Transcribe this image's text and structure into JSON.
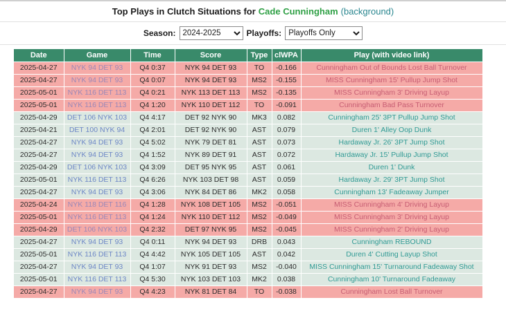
{
  "title": {
    "prefix": "Top Plays in Clutch Situations for",
    "player": "Cade Cunningham",
    "background_link": "(background)"
  },
  "controls": {
    "season_label": "Season:",
    "season_value": "2024-2025",
    "playoffs_label": "Playoffs:",
    "playoffs_value": "Playoffs Only"
  },
  "table": {
    "columns": [
      "Date",
      "Game",
      "Time",
      "Score",
      "Type",
      "clWPA",
      "Play (with video link)"
    ],
    "rows": [
      {
        "date": "2025-04-27",
        "game": "NYK 94 DET 93",
        "time": "Q4 0:37",
        "score": "NYK 94 DET 93",
        "type": "TO",
        "clwpa": "-0.166",
        "play": "Cunningham Out of Bounds Lost Ball Turnover",
        "tone": "pink"
      },
      {
        "date": "2025-04-27",
        "game": "NYK 94 DET 93",
        "time": "Q4 0:07",
        "score": "NYK 94 DET 93",
        "type": "MS2",
        "clwpa": "-0.155",
        "play": "MISS Cunningham 15' Pullup Jump Shot",
        "tone": "pink"
      },
      {
        "date": "2025-05-01",
        "game": "NYK 116 DET 113",
        "time": "Q4 0:21",
        "score": "NYK 113 DET 113",
        "type": "MS2",
        "clwpa": "-0.135",
        "play": "MISS Cunningham 3' Driving Layup",
        "tone": "pink"
      },
      {
        "date": "2025-05-01",
        "game": "NYK 116 DET 113",
        "time": "Q4 1:20",
        "score": "NYK 110 DET 112",
        "type": "TO",
        "clwpa": "-0.091",
        "play": "Cunningham Bad Pass Turnover",
        "tone": "pink"
      },
      {
        "date": "2025-04-29",
        "game": "DET 106 NYK 103",
        "time": "Q4 4:17",
        "score": "DET 92 NYK 90",
        "type": "MK3",
        "clwpa": "0.082",
        "play": "Cunningham 25' 3PT Pullup Jump Shot",
        "tone": "green"
      },
      {
        "date": "2025-04-21",
        "game": "DET 100 NYK 94",
        "time": "Q4 2:01",
        "score": "DET 92 NYK 90",
        "type": "AST",
        "clwpa": "0.079",
        "play": "Duren 1' Alley Oop Dunk",
        "tone": "green"
      },
      {
        "date": "2025-04-27",
        "game": "NYK 94 DET 93",
        "time": "Q4 5:02",
        "score": "NYK 79 DET 81",
        "type": "AST",
        "clwpa": "0.073",
        "play": "Hardaway Jr. 26' 3PT Jump Shot",
        "tone": "green"
      },
      {
        "date": "2025-04-27",
        "game": "NYK 94 DET 93",
        "time": "Q4 1:52",
        "score": "NYK 89 DET 91",
        "type": "AST",
        "clwpa": "0.072",
        "play": "Hardaway Jr. 15' Pullup Jump Shot",
        "tone": "green"
      },
      {
        "date": "2025-04-29",
        "game": "DET 106 NYK 103",
        "time": "Q4 3:09",
        "score": "DET 95 NYK 95",
        "type": "AST",
        "clwpa": "0.061",
        "play": "Duren 1' Dunk",
        "tone": "green"
      },
      {
        "date": "2025-05-01",
        "game": "NYK 116 DET 113",
        "time": "Q4 6:26",
        "score": "NYK 103 DET 98",
        "type": "AST",
        "clwpa": "0.059",
        "play": "Hardaway Jr. 29' 3PT Jump Shot",
        "tone": "green"
      },
      {
        "date": "2025-04-27",
        "game": "NYK 94 DET 93",
        "time": "Q4 3:06",
        "score": "NYK 84 DET 86",
        "type": "MK2",
        "clwpa": "0.058",
        "play": "Cunningham 13' Fadeaway Jumper",
        "tone": "green"
      },
      {
        "date": "2025-04-24",
        "game": "NYK 118 DET 116",
        "time": "Q4 1:28",
        "score": "NYK 108 DET 105",
        "type": "MS2",
        "clwpa": "-0.051",
        "play": "MISS Cunningham 4' Driving Layup",
        "tone": "pink"
      },
      {
        "date": "2025-05-01",
        "game": "NYK 116 DET 113",
        "time": "Q4 1:24",
        "score": "NYK 110 DET 112",
        "type": "MS2",
        "clwpa": "-0.049",
        "play": "MISS Cunningham 3' Driving Layup",
        "tone": "pink"
      },
      {
        "date": "2025-04-29",
        "game": "DET 106 NYK 103",
        "time": "Q4 2:32",
        "score": "DET 97 NYK 95",
        "type": "MS2",
        "clwpa": "-0.045",
        "play": "MISS Cunningham 2' Driving Layup",
        "tone": "pink"
      },
      {
        "date": "2025-04-27",
        "game": "NYK 94 DET 93",
        "time": "Q4 0:11",
        "score": "NYK 94 DET 93",
        "type": "DRB",
        "clwpa": "0.043",
        "play": "Cunningham REBOUND",
        "tone": "green"
      },
      {
        "date": "2025-05-01",
        "game": "NYK 116 DET 113",
        "time": "Q4 4:42",
        "score": "NYK 105 DET 105",
        "type": "AST",
        "clwpa": "0.042",
        "play": "Duren 4' Cutting Layup Shot",
        "tone": "green"
      },
      {
        "date": "2025-04-27",
        "game": "NYK 94 DET 93",
        "time": "Q4 1:07",
        "score": "NYK 91 DET 93",
        "type": "MS2",
        "clwpa": "-0.040",
        "play": "MISS Cunningham 15' Turnaround Fadeaway Shot",
        "tone": "green"
      },
      {
        "date": "2025-05-01",
        "game": "NYK 116 DET 113",
        "time": "Q4 5:30",
        "score": "NYK 103 DET 103",
        "type": "MK2",
        "clwpa": "0.038",
        "play": "Cunningham 10' Turnaround Fadeaway",
        "tone": "green"
      },
      {
        "date": "2025-04-27",
        "game": "NYK 94 DET 93",
        "time": "Q4 4:23",
        "score": "NYK 81 DET 84",
        "type": "TO",
        "clwpa": "-0.038",
        "play": "Cunningham Lost Ball Turnover",
        "tone": "pink"
      }
    ]
  },
  "colors": {
    "header_bg": "#398a6a",
    "row_pink": "#f5aaa7",
    "row_green": "#dce8e1",
    "game_link_pink": "#9a87b8",
    "game_link_green": "#6d87c6",
    "play_link_pink": "#c75d73",
    "play_link_green": "#2f9a94",
    "title_player": "#2fa045",
    "background_link": "#27858e"
  }
}
